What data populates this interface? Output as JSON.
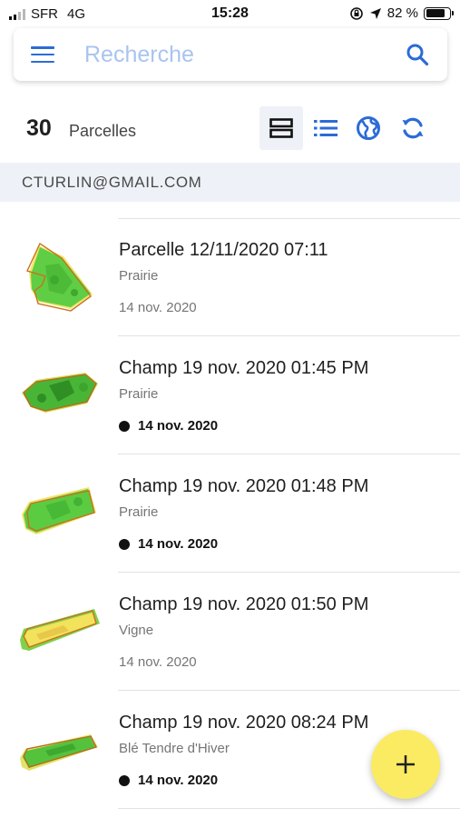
{
  "status_bar": {
    "carrier": "SFR",
    "network": "4G",
    "time": "15:28",
    "battery": "82 %",
    "battery_level": 0.82
  },
  "search": {
    "placeholder": "Recherche"
  },
  "summary": {
    "count": "30",
    "label": "Parcelles"
  },
  "toolbar": {
    "icons": [
      "cards-view-icon",
      "list-view-icon",
      "map-globe-icon",
      "sync-icon"
    ],
    "accent_color": "#2c6bd6"
  },
  "section": {
    "label": "CTURLIN@GMAIL.COM"
  },
  "parcels": [
    {
      "title": "Parcelle 12/11/2020 07:11",
      "crop": "Prairie",
      "date": "14 nov. 2020",
      "highlighted": false
    },
    {
      "title": "Champ 19 nov. 2020 01:45 PM",
      "crop": "Prairie",
      "date": "14 nov. 2020",
      "highlighted": true
    },
    {
      "title": "Champ 19 nov. 2020 01:48 PM",
      "crop": "Prairie",
      "date": "14 nov. 2020",
      "highlighted": true
    },
    {
      "title": "Champ 19 nov. 2020 01:50 PM",
      "crop": "Vigne",
      "date": "14 nov. 2020",
      "highlighted": false
    },
    {
      "title": "Champ 19 nov. 2020 08:24 PM",
      "crop": "Blé Tendre d'Hiver",
      "date": "14 nov. 2020",
      "highlighted": true
    }
  ],
  "fab": {
    "icon": "plus-icon",
    "color": "#fbeb63"
  }
}
